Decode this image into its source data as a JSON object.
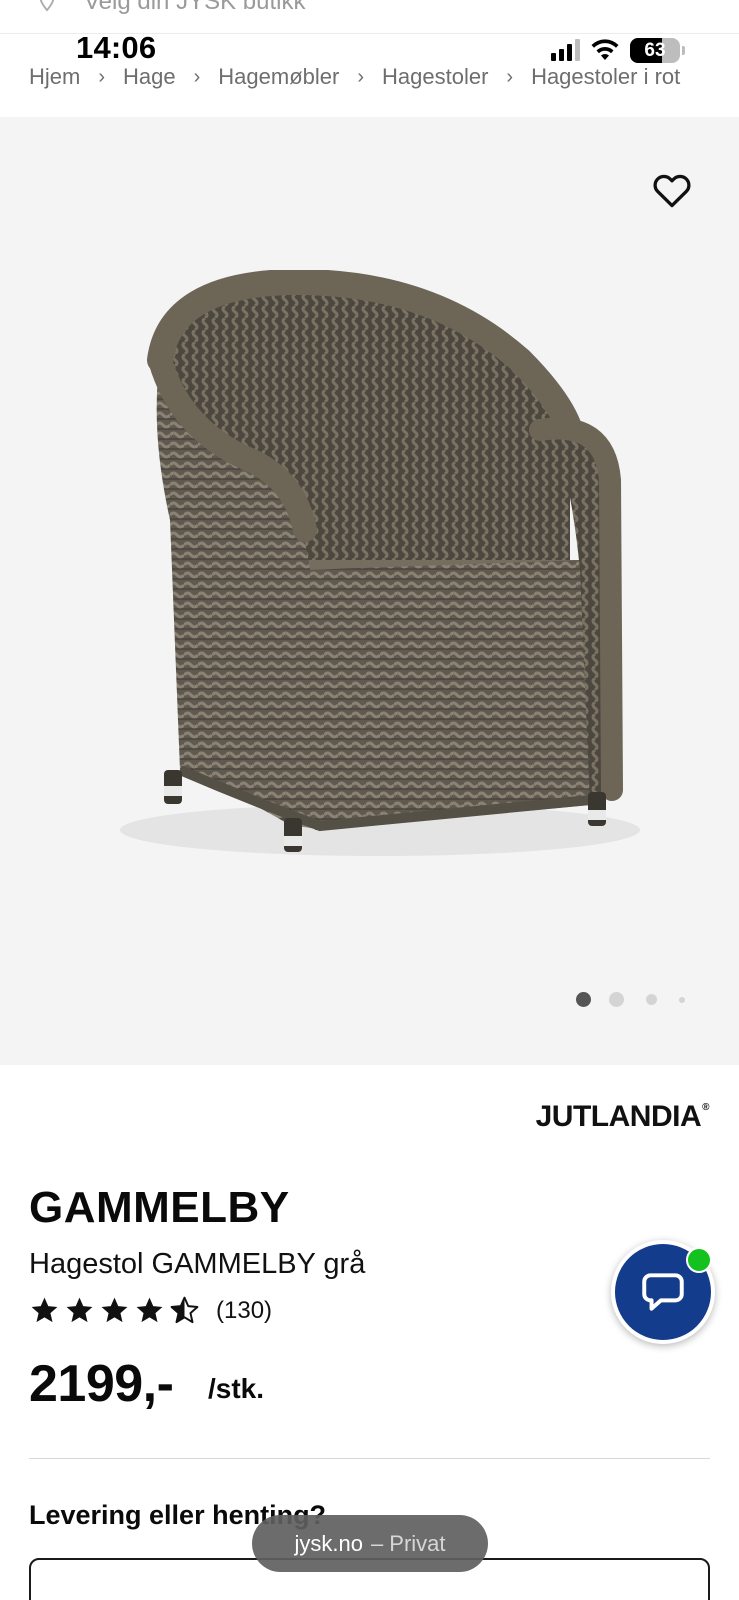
{
  "store_bar": {
    "text": "Velg din JYSK butikk",
    "icon": "location-pin-icon"
  },
  "status_bar": {
    "time": "14:06",
    "battery": "63",
    "battery_level": 0.63,
    "icons": [
      "cellular-signal-icon",
      "wifi-icon",
      "battery-icon"
    ]
  },
  "breadcrumb": {
    "separator": "›",
    "items": [
      "Hjem",
      "Hage",
      "Hagemøbler",
      "Hagestoler",
      "Hagestoler i rot"
    ]
  },
  "gallery": {
    "image": "wicker-garden-chair",
    "favorite_icon": "heart-outline-icon",
    "background": "#f4f4f4",
    "pages": 4,
    "active_page": 1
  },
  "product": {
    "brand": "JUTLANDIA",
    "brand_mark": "®",
    "name": "GAMMELBY",
    "description": "Hagestol GAMMELBY grå",
    "rating": 4.5,
    "rating_count": "(130)",
    "price": "2199,-",
    "unit": "/stk."
  },
  "delivery": {
    "title": "Levering eller henting?"
  },
  "chat": {
    "icon": "chat-bubble-icon",
    "status_color": "#13c21e",
    "button_color": "#143c8c"
  },
  "browser": {
    "domain": "jysk.no",
    "mode": "– Privat"
  }
}
